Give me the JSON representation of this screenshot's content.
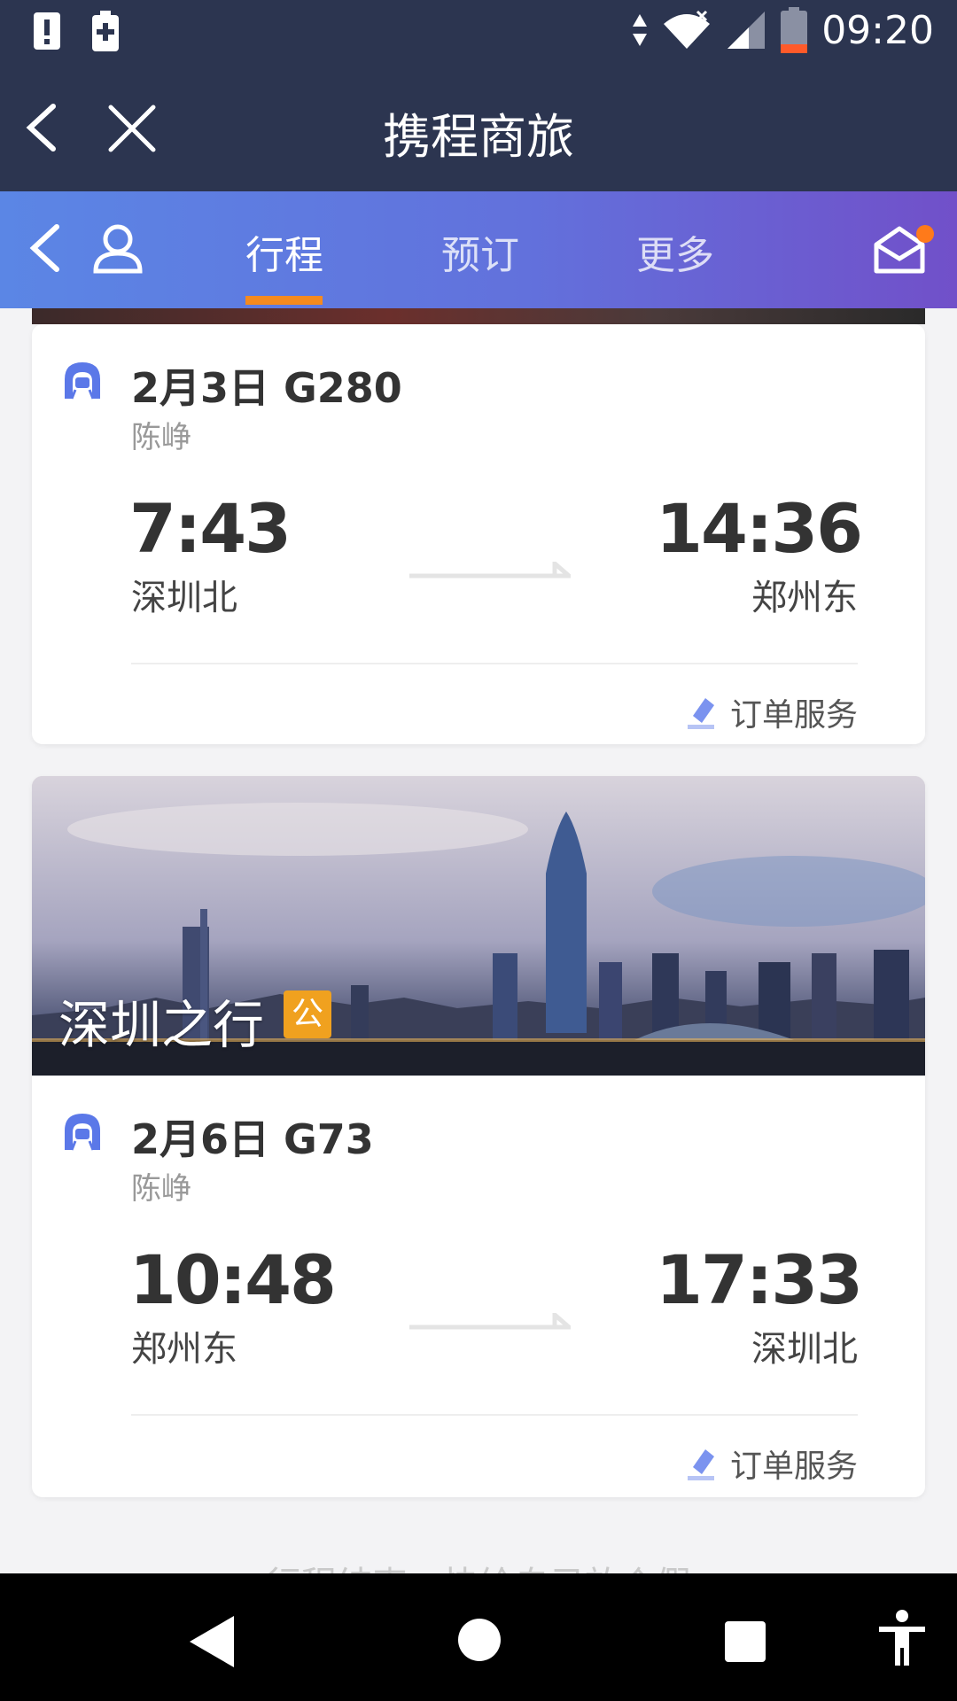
{
  "status_bar": {
    "time": "09:20"
  },
  "app": {
    "title": "携程商旅"
  },
  "nav": {
    "tabs": [
      {
        "label": "行程",
        "active": true
      },
      {
        "label": "预订",
        "active": false
      },
      {
        "label": "更多",
        "active": false
      }
    ],
    "has_unread_mail": true
  },
  "trips": [
    {
      "title": "2月3日 G280",
      "passenger": "陈峥",
      "depart_time": "7:43",
      "depart_station": "深圳北",
      "arrive_time": "14:36",
      "arrive_station": "郑州东",
      "service_label": "订单服务"
    },
    {
      "banner_title": "深圳之行",
      "banner_badge": "公",
      "title": "2月6日 G73",
      "passenger": "陈峥",
      "depart_time": "10:48",
      "depart_station": "郑州东",
      "arrive_time": "17:33",
      "arrive_station": "深圳北",
      "service_label": "订单服务"
    }
  ],
  "footer_hint": "行程结束，快给自己放个假",
  "colors": {
    "accent": "#f58a1f",
    "header": "#2c3550",
    "icon_blue": "#5b78e8"
  }
}
